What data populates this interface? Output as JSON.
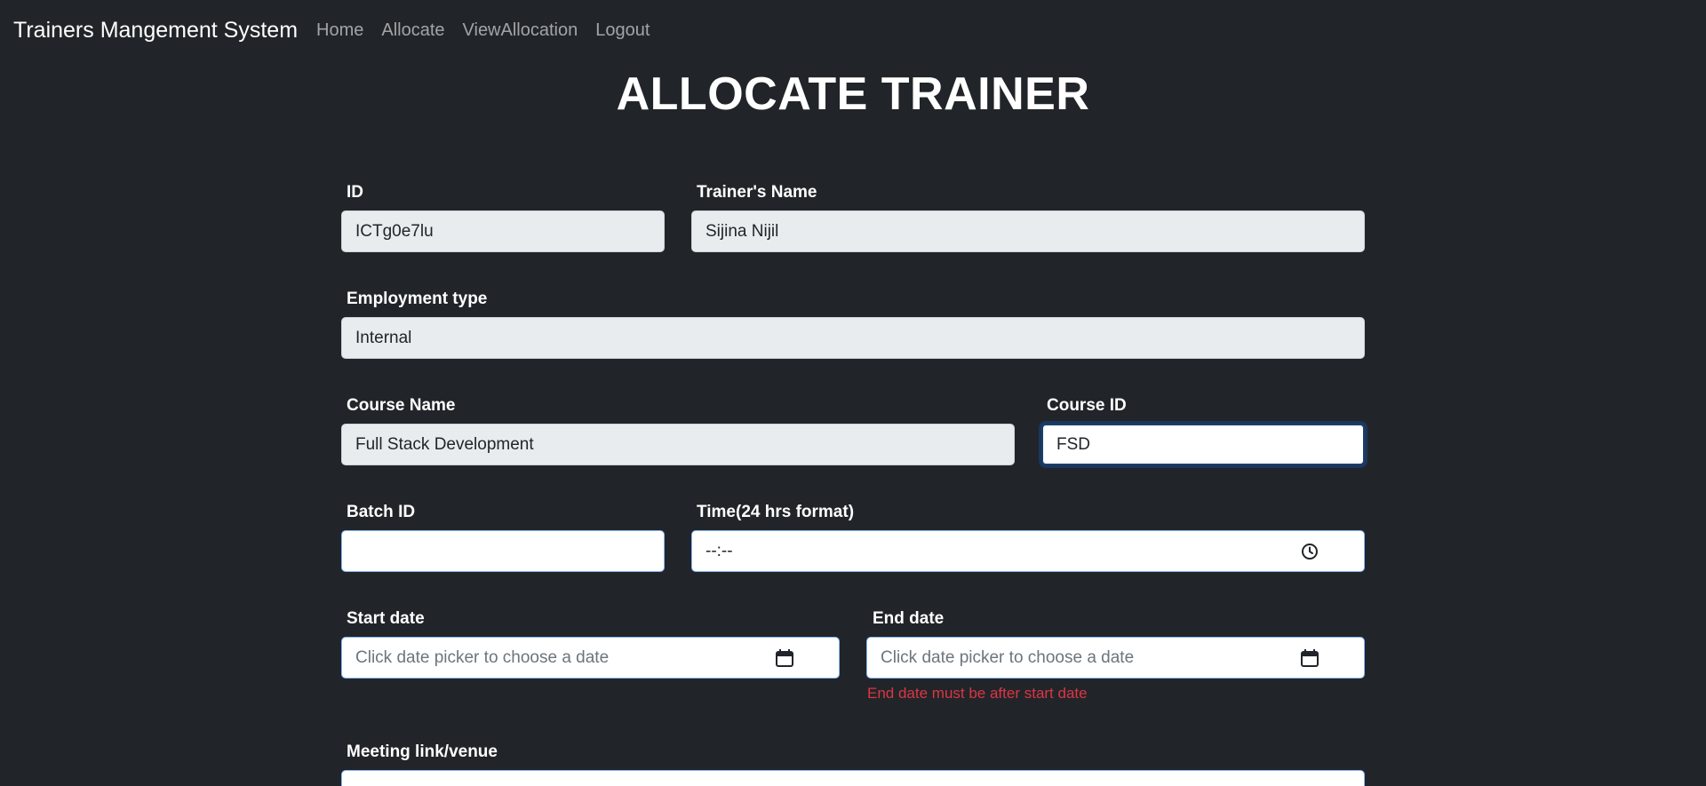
{
  "navbar": {
    "brand": "Trainers Mangement System",
    "links": [
      "Home",
      "Allocate",
      "ViewAllocation",
      "Logout"
    ]
  },
  "page": {
    "title": "ALLOCATE TRAINER"
  },
  "form": {
    "id": {
      "label": "ID",
      "value": "ICTg0e7lu"
    },
    "trainer_name": {
      "label": "Trainer's Name",
      "value": "Sijina Nijil"
    },
    "employment_type": {
      "label": "Employment type",
      "value": "Internal"
    },
    "course_name": {
      "label": "Course Name",
      "value": "Full Stack Development"
    },
    "course_id": {
      "label": "Course ID",
      "value": "FSD"
    },
    "batch_id": {
      "label": "Batch ID",
      "value": ""
    },
    "time": {
      "label": "Time(24 hrs format)",
      "value": "--:--",
      "icon": "clock-icon"
    },
    "start_date": {
      "label": "Start date",
      "placeholder": "Click date picker to choose a date",
      "icon": "calendar-icon"
    },
    "end_date": {
      "label": "End date",
      "placeholder": "Click date picker to choose a date",
      "icon": "calendar-icon",
      "error": "End date must be after start date"
    },
    "meeting_link": {
      "label": "Meeting link/venue",
      "value": ""
    }
  },
  "colors": {
    "background": "#212529",
    "readonly_field": "#e9ecef",
    "error": "#dc3545"
  }
}
